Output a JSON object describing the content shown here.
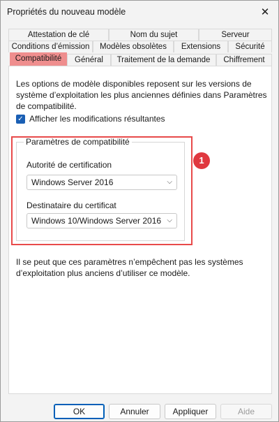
{
  "window": {
    "title": "Propriétés du nouveau modèle",
    "close_glyph": "✕"
  },
  "tabs": {
    "row1": [
      "Attestation de clé",
      "Nom du sujet",
      "Serveur"
    ],
    "row2": [
      "Conditions d’émission",
      "Modèles obsolètes",
      "Extensions",
      "Sécurité"
    ],
    "row3": [
      "Compatibilité",
      "Général",
      "Traitement de la demande",
      "Chiffrement"
    ],
    "active": "Compatibilité",
    "active_color": "#ef8e8e"
  },
  "panel": {
    "description": "Les options de modèle disponibles reposent sur les versions de système d’exploitation les plus anciennes définies dans Paramètres de compatibilité.",
    "checkbox_label": "Afficher les modifications résultantes",
    "checkbox_checked": true,
    "group_title": "Paramètres de compatibilité",
    "ca_label": "Autorité de certification",
    "ca_value": "Windows Server 2016",
    "recipient_label": "Destinataire du certificat",
    "recipient_value": "Windows 10/Windows Server 2016",
    "warning": "Il se peut que ces paramètres n’empêchent pas les systèmes d’exploitation plus anciens d’utiliser ce modèle."
  },
  "annotation": {
    "marker_number": "1",
    "color": "#e84a4a"
  },
  "buttons": {
    "ok": "OK",
    "cancel": "Annuler",
    "apply": "Appliquer",
    "help": "Aide"
  }
}
